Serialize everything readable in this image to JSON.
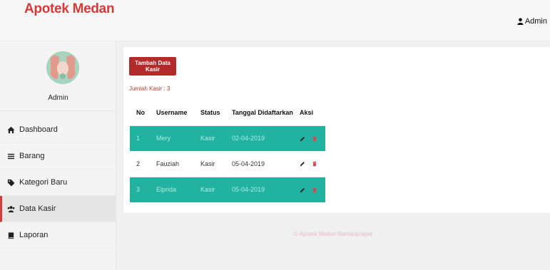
{
  "app": {
    "brand": "Apotek Medan"
  },
  "header": {
    "user_label": "Admin",
    "user_icon": "user-icon"
  },
  "sidebar": {
    "profile_name": "Admin",
    "items": [
      {
        "label": "Dashboard",
        "icon": "home-icon",
        "active": false
      },
      {
        "label": "Barang",
        "icon": "bars-icon",
        "active": false
      },
      {
        "label": "Kategori Baru",
        "icon": "tag-icon",
        "active": false
      },
      {
        "label": "Data Kasir",
        "icon": "users-icon",
        "active": true
      },
      {
        "label": "Laporan",
        "icon": "book-icon",
        "active": false
      }
    ]
  },
  "main": {
    "add_button": "Tambah Data Kasir",
    "count_label": "Jumlah Kasir : 3",
    "table": {
      "headers": [
        "No",
        "Username",
        "Status",
        "Tanggal Didaftarkan",
        "Aksi"
      ],
      "rows": [
        {
          "no": "1",
          "username": "Mery",
          "status": "Kasir",
          "date": "02-04-2019"
        },
        {
          "no": "2",
          "username": "Fauziah",
          "status": "Kasir",
          "date": "05-04-2019"
        },
        {
          "no": "3",
          "username": "Elprida",
          "status": "Kasir",
          "date": "05-04-2019"
        }
      ]
    },
    "footer": "© Apotek Medan Rantauprapat"
  },
  "colors": {
    "brand": "#d33a3a",
    "button": "#b32a2a",
    "teal_row": "#22b2a0",
    "delete_icon": "#e0404a"
  }
}
